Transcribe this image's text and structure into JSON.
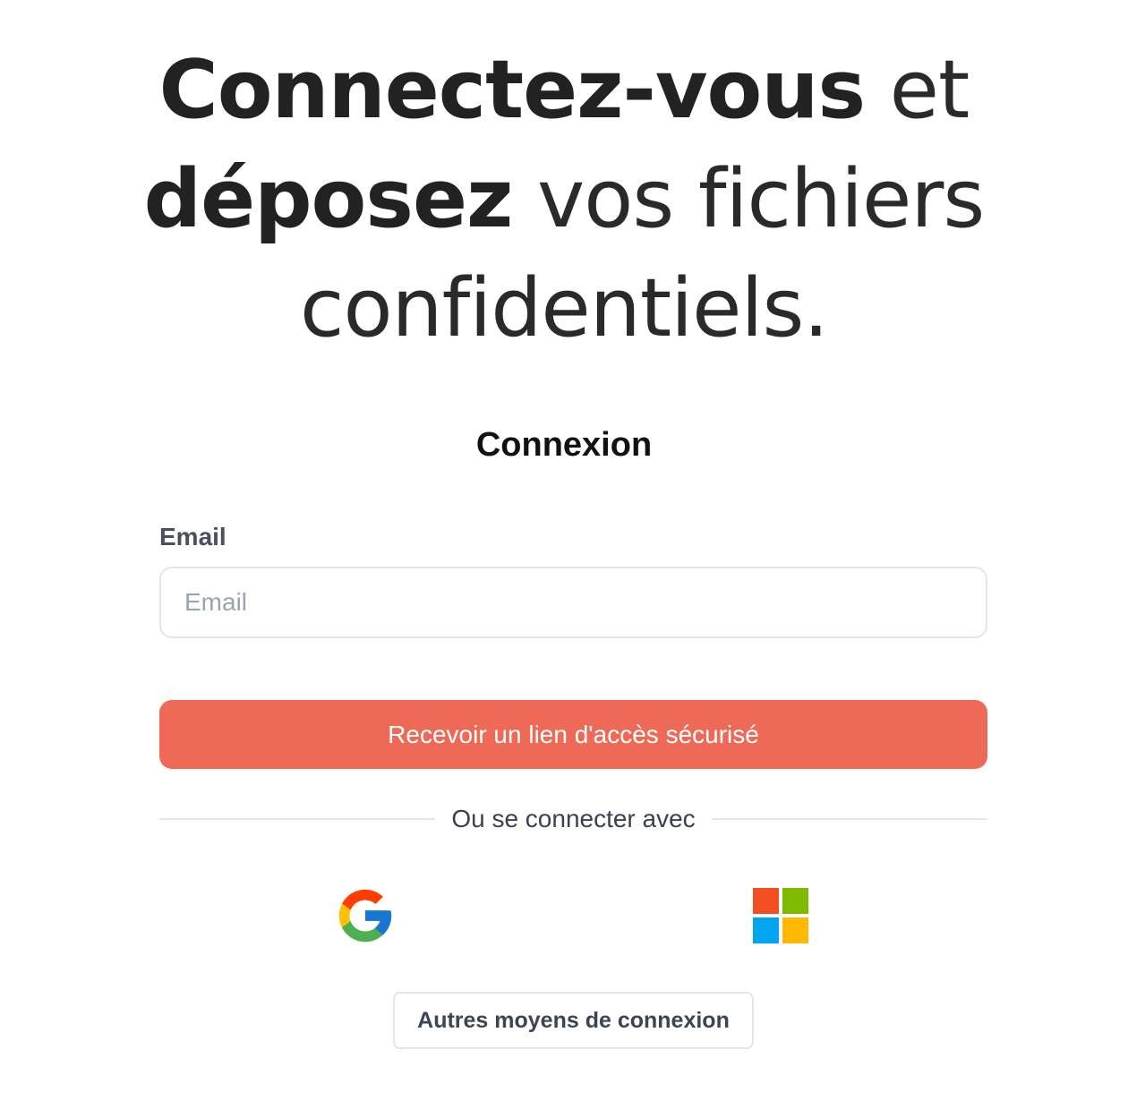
{
  "hero": {
    "line1_bold": "Connectez-vous",
    "line1_light": " et",
    "line2_bold": "déposez",
    "line2_light": " vos fichiers",
    "line3_light": "confidentiels."
  },
  "form": {
    "title": "Connexion",
    "email_label": "Email",
    "email_placeholder": "Email",
    "email_value": "",
    "submit_label": "Recevoir un lien d'accès sécurisé",
    "divider_text": "Ou se connecter avec",
    "other_methods_label": "Autres moyens de connexion"
  },
  "social": {
    "google_icon": "google-logo-icon",
    "microsoft_icon": "microsoft-logo-icon"
  },
  "colors": {
    "accent": "#ee6a57",
    "heading": "#222222",
    "label": "#4a5060",
    "placeholder": "#9aa3b2",
    "border": "#e3e5ea"
  }
}
